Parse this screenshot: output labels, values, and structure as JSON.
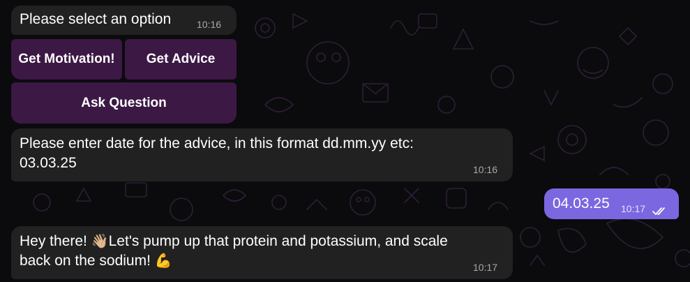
{
  "messages": [
    {
      "text": "Please select an option",
      "time": "10:16"
    },
    {
      "text": "Please enter date for the advice, in this format dd.mm.yy etc:",
      "text_line2": "03.03.25",
      "time": "10:16"
    },
    {
      "text": "04.03.25",
      "time": "10:17",
      "status_icon": "double-check-icon"
    },
    {
      "text": "Hey there! ",
      "emoji_1": "👋🏼",
      "text_cont": "Let's pump up that protein and potassium, and scale",
      "text_line2": "back on the sodium! ",
      "emoji_2": "💪",
      "time": "10:17"
    }
  ],
  "keyboard": {
    "buttons": [
      "Get Motivation!",
      "Get Advice",
      "Ask Question"
    ]
  },
  "colors": {
    "background": "#0b0b0d",
    "incoming_bubble": "#212121",
    "outgoing_bubble": "#7b67e0",
    "keyboard_button": "#4a1c54"
  }
}
